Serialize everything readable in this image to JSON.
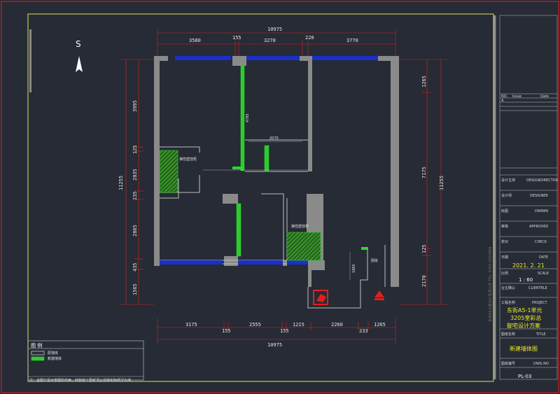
{
  "compass": {
    "label": "S"
  },
  "dimensions": {
    "top_total": "10975",
    "top_segments": [
      "3580",
      "155",
      "3270",
      "220",
      "3770"
    ],
    "bottom_segments": [
      "3175",
      "155",
      "2555",
      "155",
      "1215",
      "2260",
      "233",
      "1265"
    ],
    "bottom_total": "10975",
    "left_total": "11255",
    "left_segments": [
      "3995",
      "125",
      "2035",
      "235",
      "2865",
      "435",
      "1565"
    ],
    "right_total": "11255",
    "right_segments": [
      "1265",
      "7175",
      "125",
      "2170"
    ],
    "interior": [
      "2070",
      "1865",
      "4785"
    ]
  },
  "annotations": {
    "shaft_label_1": "弹性壁挂柜",
    "shaft_label_2": "弹性壁挂柜",
    "small_room": "厨房"
  },
  "legend": {
    "title": "图 例",
    "items": [
      "原墙体",
      "新建墙体"
    ],
    "note": "注：本图只是示意图的作用，结构施工图纸须以现场实际情况为准。"
  },
  "title_block": {
    "vertical_text": "东街AS大厦设计有限公司   TEL: 0793-3350999",
    "rev_header": {
      "no": "NO.",
      "issue": "Issue",
      "date": "Date"
    },
    "rev_mark": "A",
    "rows": [
      {
        "cn": "设计主持",
        "en": "DESIGNDIRECTOR"
      },
      {
        "cn": "设计师",
        "en": "DESIGNER"
      },
      {
        "cn": "绘图",
        "en": "DRAWN"
      },
      {
        "cn": "审核",
        "en": "APPROVED"
      },
      {
        "cn": "校对",
        "en": "CHECK"
      }
    ],
    "date_cn": "日期",
    "date_en": "DATE",
    "date_value": "2021. 2. 21",
    "scale_cn": "比例",
    "scale_en": "SCALE",
    "scale_value": "1 : 60",
    "client_cn": "业主确认",
    "client_en": "CLIENTELE",
    "project_cn": "工程名称",
    "project_en": "PROJECT",
    "project_lines": [
      "东街A5-1单元",
      "3205室彩总",
      "御宅设计方案"
    ],
    "title_cn": "图纸名称",
    "title_en": "TITLE",
    "title_value": "新建墙体图",
    "dwg_cn": "图纸编号",
    "dwg_en": "DWG.NO",
    "dwg_value": "PL-03"
  },
  "colors": {
    "background": "#262b35",
    "frame_red": "#e02020",
    "frame_yellow": "#e0e060",
    "dim_red": "#e02020",
    "wall_gray": "#8a8a8a",
    "window_blue": "#1a30c8",
    "new_wall_green": "#2fd62f"
  }
}
